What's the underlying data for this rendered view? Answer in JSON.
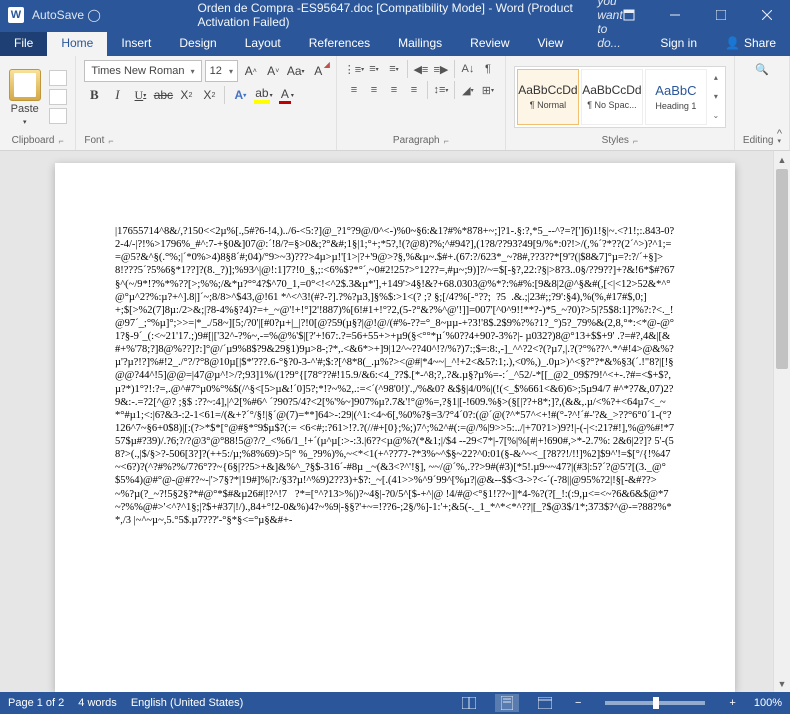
{
  "titlebar": {
    "autosave": "AutoSave ◯",
    "title": "Orden de Compra -ES95647.doc [Compatibility Mode] - Word (Product Activation Failed)"
  },
  "tabs": {
    "file": "File",
    "home": "Home",
    "insert": "Insert",
    "design": "Design",
    "layout": "Layout",
    "references": "References",
    "mailings": "Mailings",
    "review": "Review",
    "view": "View",
    "tellme": "Tell me what you want to do...",
    "signin": "Sign in",
    "share": "Share"
  },
  "ribbon": {
    "clipboard": {
      "paste": "Paste",
      "label": "Clipboard"
    },
    "font": {
      "name": "Times New Roman",
      "size": "12",
      "label": "Font"
    },
    "paragraph": {
      "label": "Paragraph"
    },
    "styles": {
      "items": [
        {
          "preview": "AaBbCcDd",
          "name": "¶ Normal"
        },
        {
          "preview": "AaBbCcDd",
          "name": "¶ No Spac..."
        },
        {
          "preview": "AaBbC",
          "name": "Heading 1"
        }
      ],
      "label": "Styles"
    },
    "editing": {
      "label": "Editing"
    }
  },
  "document": {
    "body": "|17655714^8&/,?150<<2µ%[.,5#?6-!4,)../6-<5:?]@_?1°?9@/0^<-)%0~§6:&1?#%*878+~;]?1-.§:?,*5_--^?=?[']6)1!§|~.<?1!;:.843-0?2-4/-|?!%>1796%_#^:7-+§0&]07@:´!8/?=§>0&;?°&#;1§|1;°+;*5?,!(?@8)?%;^#94?],(1?8/??93?49[9/%*:0?!>/(,%´?*??(2´^>)?^1;==@5?&^§(.°%;|´*0%>4)8§8´#;04)/°9>~3)???>4µ>µ!'[1>|?+'9@>?§,%&µ~.$#+.(67:?/623*_~?8#,??3??*[9'?(|$8&7]°µ=?:?/´+§]>8!???5´?5%6§*1??]?(8._?)];%93^|@!:1]7?!0_§,;:<6%$?*°´,~0#2!25?>°12??=,#µ~;9)]?/~=$[-§?,22:?§|>8?3..0§/??9??]+?&!6*$#?67§^(~/9*!?%*%??[>;%%;/&*µ?°°4?$^70_1,=0°<!<^2$.3&µ*'],+149'>4§!&?+68.0303@%*?:%#%:[9&8|2@^§&#(,[<|<12>52&*^°@°µ^2?%:µ?+^].8|]´~;8/8>^$43,@!61 *^<^3!(#?-?].?%?µ3,]§%$:>1<(? ;? §;[/4?%[-°??;  ?5  .&.;|23#;;?9':§4),%(%,#17#$,0;]+;$[>%2(7]8µ:/2>&;|?8-4%§?4)?=+_~@'!+!°]2'!887)%[6!#1+!°?2,(5-?°&?%^@'!]]=007'[^0^9!!**?-)*5_~?0)?>5|?5$8:1]?%?:?<._!@97´_;°%µ]°;>>=|*_./58~][5;/?0'|[#0?µ+|_|?!0[@?59(µ§?|@!@/(#%-??=°_8~µµ-+?3!'8$.2$9%?%?1?_°)5?_79%&(2,8,°*:<*@-@°1?§-9´_(:<~21'17.;)9#[|['32^-?%~,-=%@%'$|[?'+!67:.?=56+55+>+µ9(§<°°*µ´%0??4+90?-3%?|- µ032?)8@°13+$$+9' .?=#?,4&|[&#+%'78;?]8@%??]?:]°@/´µ9%8$?9&29§1)9µ>8-;?*,.<&6*>+]9|12^~??40^!?/%?)7:;$=:8:,-]_^^?2<?(?µ7,|.?(?°%??^.*^#!4>@&%?µ'?µ?!?]%#!2_./°?/?°8@10µ[|$*'???.6-°§?0-3-^'#;$:?[^8*8(_.µ%?><@#|*4~~|_^!+2<&5?:1;.),<0%,)_.0µ>)^<§?°?*&%§3(´.!\"8?|[!§@@?44^!5]@@=|47@µ^!>/?;93]1%/(1?9°{[78°??#!15.9/&6:<4_??$.[*-^8;?,.?&.µ§?µ%=-:´_^52/-*[[_@2_09$?9!^<+-.?#=<$+$?,µ?*)1°?!:?=,.@^#7°µ0%°%$(/^§<[5>µ&!´0]5?;*!?~%2,.:=<´(^98'0!)'.,/%&0? &$§|4/0%|(!(<_$%661<&6)6>;5µ94/7 #^*?7&,07)2?9&:-.=?2[^@? ;§$ :??~:4],|^2[%#6^ ´?90?5/4?<2[%'%~]907%µ?.7&'!°@%=,?§1|[-!609.%§>(§[|??+8*;]?,(&&,.µ/<%?+<64µ7<_~*°#µ1;<:|6?&3-:2-1<61=/(&+?´°/§!|§´@(7)=**]64>-:29|(^1:<4~6[,%0%?§=3/?°4´0?:(@´@(?^*57^<+!#(°-?^!´#-'?&_>??°6°0´1-(°?126^7~§6+0$8)|[:(?>*$*[°@#§*°9$µ$?(:= <6<#;:?61>!?.?(//#+[0};%;)7^;%2^#(:=@/%|9>>5:../|+70?1>)9?!|-(-|<:21?#!],%@%#!*757$µ#?39)/.?6;?/?@3°@°88!5@?/?_<%6/1_!+´(µ^µ[:>-:3.|6??<µ@%?(*&1;|/$4 --29<7*|-7[%|%[#|+!690#,>*-2.7%: 2&6|2?]? 5'-(58?>(.,|$/§>?-506[3?]?(++5:/µ;%8%69)>5|° %_?9%)%,~<*<1(+^??7?-?*3%~^$§~22?^0:01(§-&^~<_[?8??!/!!]%2]$9^'!=$[°/{!%47~<6?)?(^?#%?%/7?6°??~{6§|??5>+&]&%^_?§$-316´-#8µ _~(&3<?^'!§], ~~/@´%,.??>9#(#3)[*5!.µ9~~47?|(#3|:5?´?@5'?[(3._@°$5%4)@#°@-@#??~-|'>7§?*|19#]%|?:/§3?µ!^%9)2??3)+$?:_~[.(41>>%^9´99^[%µ?|@&--$$<3->?<-´(-?8||@95%?2|!§[-&#??>~%?µ(?_~?!5§2§?*#@°*$#&µ26#|!?^!7   ?*=[°^?13>%|)?~4§|-?0/5^[$-+^|@ !4/#@<°§1!??~]|*4-%?(?[_!:(:9,µ<=<~?6&6&$@*7~?%%@#>'<^?^1§;|?$+#37|!/).,84+°!2-0&%)4?~%9|-§§?'+~=!??6-;2§/%]-1:'+;&5(-._1_*^*<*^??|[_?$@3$/1*;373$?^@-=?88?%**,/3 |~^~µ~,5.°5$.µ7???'-°§*§<=°µ§&#+-"
  },
  "statusbar": {
    "page": "Page 1 of 2",
    "words": "4 words",
    "lang": "English (United States)",
    "zoom": "100%"
  },
  "watermark": {
    "main": "",
    "sub": ""
  }
}
